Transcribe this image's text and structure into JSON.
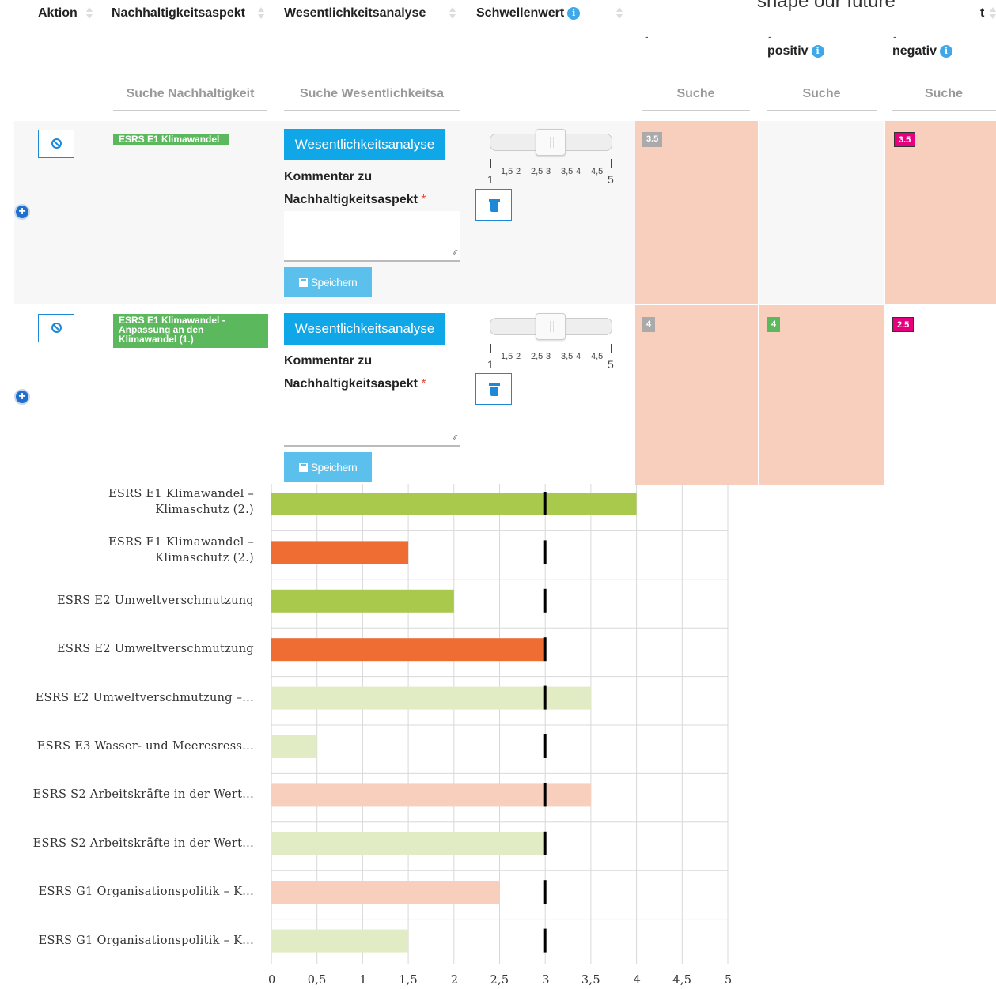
{
  "header": {
    "columns": [
      {
        "label": "Aktion"
      },
      {
        "label": "Nachhaltigkeitsaspekt"
      },
      {
        "label": "Wesentlichkeitsanalyse"
      },
      {
        "label": "Schwellenwert"
      }
    ],
    "banner_text": "shape our future",
    "corner_text": "t",
    "sub_dash": "-",
    "positiv_label": "positiv",
    "negativ_label": "negativ"
  },
  "search": {
    "nachhaltigkeitsaspekt": "Suche Nachhaltigkeit",
    "wesentlichkeitsanalyse": "Suche Wesentlichkeitsa",
    "col5": "Suche",
    "col6": "Suche",
    "col7": "Suche"
  },
  "rows": [
    {
      "aspect_tag": "ESRS E1 Klimawandel",
      "analysis_button": "Wesentlichkeitsanalyse",
      "comment_label": "Kommentar zu Nachhaltigkeitsaspekt",
      "required_mark": "*",
      "save_label": "Speichern",
      "slider_value": 3,
      "badge1": "3.5",
      "badge2": "",
      "badge3": "3.5"
    },
    {
      "aspect_tag": "ESRS E1 Klimawandel - Anpassung an den Klimawandel (1.)",
      "analysis_button": "Wesentlichkeitsanalyse",
      "comment_label": "Kommentar zu Nachhaltigkeitsaspekt",
      "required_mark": "*",
      "save_label": "Speichern",
      "slider_value": 3,
      "badge1": "4",
      "badge2": "4",
      "badge3": "2.5"
    }
  ],
  "slider_scale": {
    "min_label": "1",
    "max_label": "5",
    "ticks": [
      "1,5",
      "2",
      "2,5",
      "3",
      "3,5",
      "4",
      "4,5"
    ]
  },
  "colors": {
    "primary_blue": "#10a7e8",
    "tag_green": "#5cb85c",
    "peach": "#f8cebd",
    "badge_gray": "#aaaaaa",
    "badge_green": "#5cb85c",
    "badge_magenta": "#e6007e"
  },
  "chart_data": {
    "type": "bar",
    "orientation": "horizontal",
    "categories": [
      "ESRS E1 Klimawandel – Klimaschutz (2.)",
      "ESRS E1 Klimawandel – Klimaschutz (2.)",
      "ESRS E2 Umweltverschmutzung",
      "ESRS E2 Umweltverschmutzung",
      "ESRS E2 Umweltverschmutzung –...",
      "ESRS E3 Wasser- und Meeresress...",
      "ESRS S2 Arbeitskräfte in der Wert...",
      "ESRS S2 Arbeitskräfte in der Wert...",
      "ESRS G1 Organisationspolitik – K...",
      "ESRS G1 Organisationspolitik – K..."
    ],
    "values": [
      4,
      1.5,
      2,
      3,
      3.5,
      0.5,
      3.5,
      3,
      2.5,
      1.5
    ],
    "bar_colors": [
      "#a8c94c",
      "#ef6c33",
      "#a8c94c",
      "#ef6c33",
      "#e1ecc4",
      "#e1ecc4",
      "#f8cebd",
      "#e1ecc4",
      "#f8cebd",
      "#e1ecc4"
    ],
    "threshold": 3,
    "xlim": [
      0,
      5
    ],
    "xticks": [
      "0",
      "0,5",
      "1",
      "1,5",
      "2",
      "2,5",
      "3",
      "3,5",
      "4",
      "4,5",
      "5"
    ],
    "grid": true
  }
}
